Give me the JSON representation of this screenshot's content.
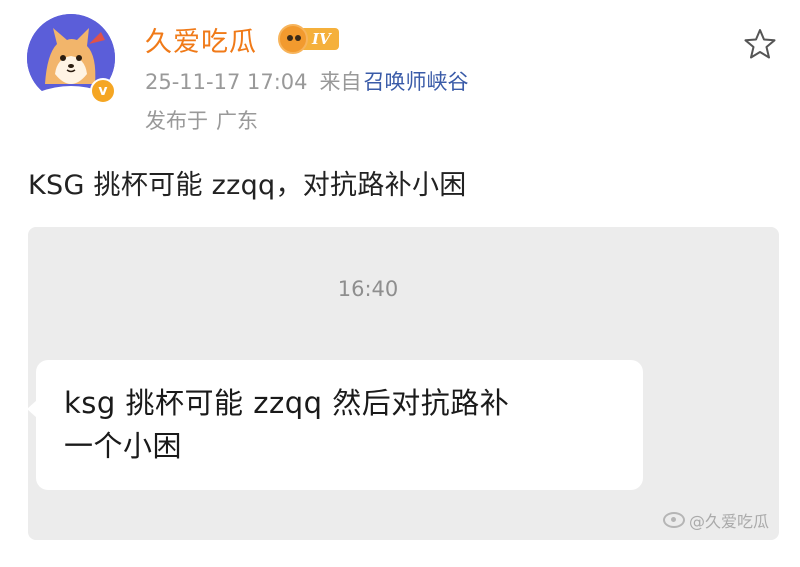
{
  "author": {
    "name": "久爱吃瓜",
    "fan_level": "IV",
    "verified_mark": "v"
  },
  "meta": {
    "timestamp": "25-11-17 17:04",
    "from_label": "来自",
    "source": "召唤师峡谷",
    "location_label": "发布于",
    "location": "广东"
  },
  "post": {
    "text": "KSG 挑杯可能 zzqq，对抗路补小困"
  },
  "image": {
    "chat_time": "16:40",
    "message_line1": "ksg 挑杯可能 zzqq 然后对抗路补",
    "message_line2": "一个小困",
    "watermark": "@久爱吃瓜"
  },
  "icons": {
    "favorite": "star-icon",
    "avatar_art": "shiba-dog-icon",
    "platform": "weibo-logo-icon"
  },
  "colors": {
    "username": "#f07a18",
    "source_link": "#3a5ba8",
    "avatar_bg": "#5b5ed9",
    "verify_badge": "#f5a623",
    "image_bg": "#ececec"
  }
}
